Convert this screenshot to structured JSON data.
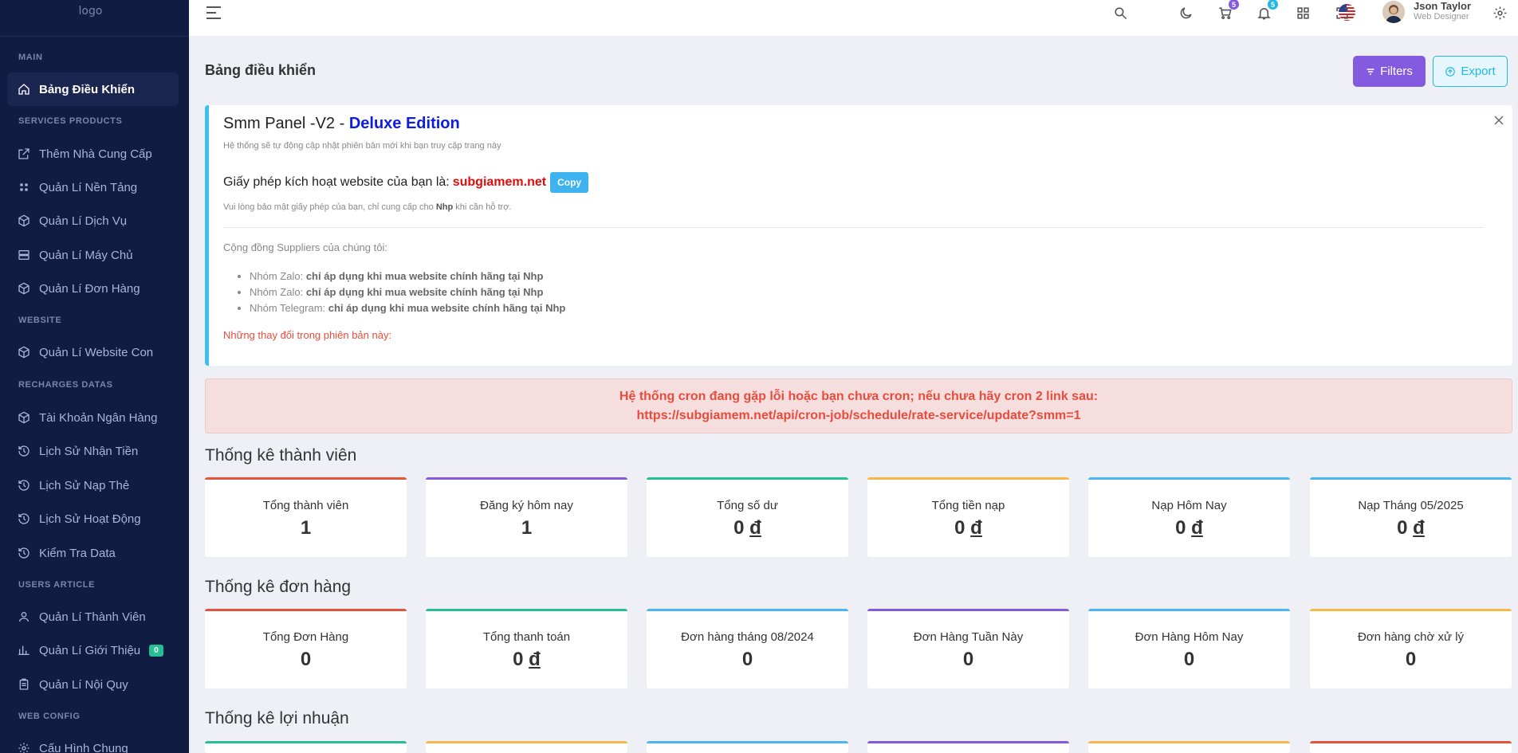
{
  "sidebar": {
    "logo_alt": "logo",
    "sections": {
      "main": "MAIN",
      "services": "SERVICES PRODUCTS",
      "website": "WEBSITE",
      "recharges": "RECHARGES DATAS",
      "users": "USERS ARTICLE",
      "config": "WEB CONFIG"
    },
    "items": {
      "dashboard": "Bảng Điều Khiển",
      "add_supplier": "Thêm Nhà Cung Cấp",
      "platforms": "Quản Lí Nền Tảng",
      "services": "Quản Lí Dịch Vụ",
      "servers": "Quản Lí Máy Chủ",
      "orders": "Quản Lí Đơn Hàng",
      "child_sites": "Quản Lí Website Con",
      "bank_accounts": "Tài Khoản Ngân Hàng",
      "receive_history": "Lịch Sử Nhận Tiền",
      "card_history": "Lịch Sử Nạp Thẻ",
      "activity_history": "Lịch Sử Hoạt Động",
      "check_data": "Kiểm Tra Data",
      "members": "Quản Lí Thành Viên",
      "referrals": "Quản Lí Giới Thiệu",
      "referrals_badge": "0",
      "rules": "Quản Lí Nội Quy",
      "general_config": "Cấu Hình Chung"
    }
  },
  "header": {
    "cart_count": "5",
    "notif_count": "5",
    "user_name": "Json Taylor",
    "user_role": "Web Designer",
    "colors": {
      "cart_badge": "#845adf",
      "notif_badge": "#23b7e5"
    }
  },
  "page": {
    "title": "Bảng điều khiển",
    "filters_label": "Filters",
    "export_label": "Export"
  },
  "notice": {
    "title_main": "Smm Panel -V2 - ",
    "title_edition": "Deluxe Edition",
    "subtitle": "Hệ thống sẽ tự động cập nhật phiên bản mới khi bạn truy cập trang này",
    "license_label": "Giấy phép kích hoạt website của bạn là:",
    "license_domain": "subgiamem.net",
    "copy_label": "Copy",
    "note_prefix": "Vui lòng bảo mật giấy phép của bạn, chỉ cung cấp cho",
    "note_bold": "Nhp",
    "note_suffix": "khi cần hỗ trợ.",
    "community_title": "Cộng đồng Suppliers của chúng tôi:",
    "community": [
      {
        "label": "Nhóm Zalo:",
        "value": "chỉ áp dụng khi mua website chính hãng tại Nhp"
      },
      {
        "label": "Nhóm Zalo:",
        "value": "chỉ áp dụng khi mua website chính hãng tại Nhp"
      },
      {
        "label": "Nhóm Telegram:",
        "value": "chỉ áp dụng khi mua website chính hãng tại Nhp"
      }
    ],
    "changes_title": "Những thay đổi trong phiên bản này:"
  },
  "alert": {
    "line1": "Hệ thống cron đang gặp lỗi hoặc bạn chưa cron; nếu chưa hãy cron 2 link sau:",
    "line2": "https://subgiamem.net/api/cron-job/schedule/rate-service/update?smm=1"
  },
  "member_stats": {
    "title": "Thống kê thành viên",
    "cards": [
      {
        "label": "Tổng thành viên",
        "value": "1",
        "color": "#e6533c"
      },
      {
        "label": "Đăng ký hôm nay",
        "value": "1",
        "color": "#845adf"
      },
      {
        "label": "Tổng số dư",
        "value": "0",
        "currency": "đ",
        "color": "#26bf94"
      },
      {
        "label": "Tổng tiền nạp",
        "value": "0",
        "currency": "đ",
        "color": "#f5b849"
      },
      {
        "label": "Nạp Hôm Nay",
        "value": "0",
        "currency": "đ",
        "color": "#49b6f5"
      },
      {
        "label": "Nạp Tháng 05/2025",
        "value": "0",
        "currency": "đ",
        "color": "#49b6f5"
      }
    ]
  },
  "order_stats": {
    "title": "Thống kê đơn hàng",
    "cards": [
      {
        "label": "Tổng Đơn Hàng",
        "value": "0",
        "color": "#e6533c"
      },
      {
        "label": "Tổng thanh toán",
        "value": "0",
        "currency": "đ",
        "color": "#26bf94"
      },
      {
        "label": "Đơn hàng tháng 08/2024",
        "value": "0",
        "color": "#49b6f5"
      },
      {
        "label": "Đơn Hàng Tuần Này",
        "value": "0",
        "color": "#845adf"
      },
      {
        "label": "Đơn Hàng Hôm Nay",
        "value": "0",
        "color": "#49b6f5"
      },
      {
        "label": "Đơn hàng chờ xử lý",
        "value": "0",
        "color": "#f5b849"
      }
    ]
  },
  "profit_stats": {
    "title": "Thống kê lợi nhuận",
    "card_colors": [
      "#26bf94",
      "#f5b849",
      "#49b6f5",
      "#845adf",
      "#f5b849",
      "#e6533c"
    ]
  }
}
